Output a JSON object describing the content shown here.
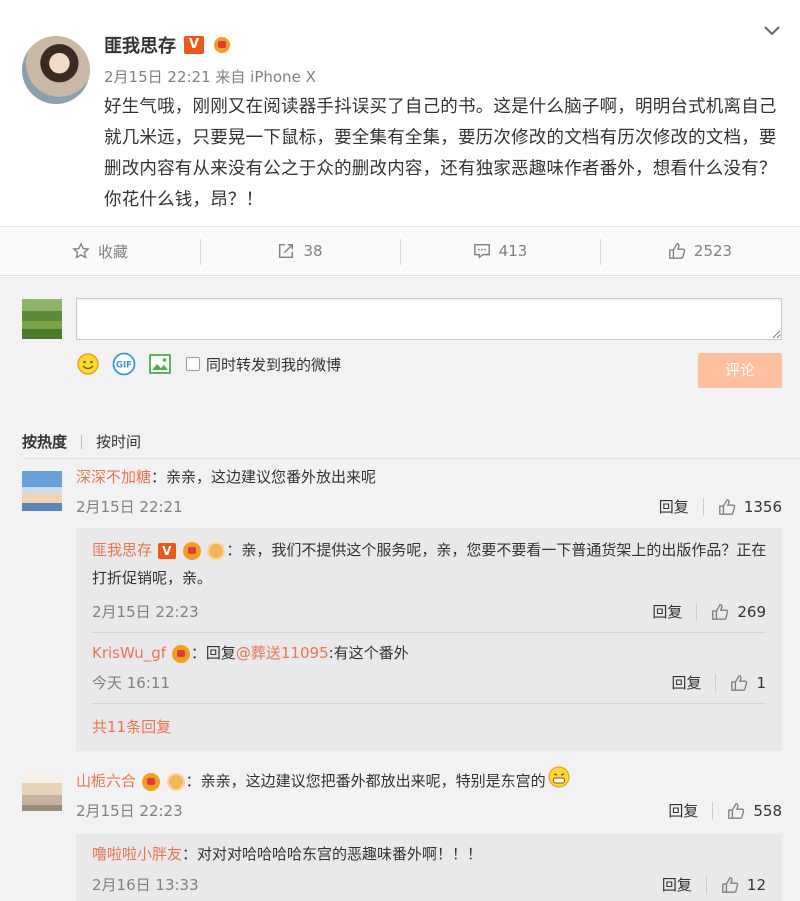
{
  "post": {
    "author": "匪我思存",
    "meta": "2月15日 22:21 来自 iPhone X",
    "body": "好生气哦，刚刚又在阅读器手抖误买了自己的书。这是什么脑子啊，明明台式机离自己就几米远，只要晃一下鼠标，要全集有全集，要历次修改的文档有历次修改的文档，要删改内容有从来没有公之于众的删改内容，还有独家恶趣味作者番外，想看什么没有？你花什么钱，昂？！"
  },
  "actions": {
    "favorite": "收藏",
    "repost": "38",
    "comment": "413",
    "like": "2523"
  },
  "composer": {
    "input_value": "",
    "repost_label": "同时转发到我的微博",
    "submit_label": "评论"
  },
  "sort": {
    "hot": "按热度",
    "time": "按时间"
  },
  "comments": [
    {
      "name": "深深不加糖",
      "text": "：亲亲，这边建议您番外放出来呢",
      "date": "2月15日 22:21",
      "reply_label": "回复",
      "likes": "1356",
      "replies": [
        {
          "name": "匪我思存",
          "text": "：亲，我们不提供这个服务呢，亲，您要不要看一下普通货架上的出版作品？正在打折促销呢，亲。",
          "date": "2月15日 22:23",
          "reply_label": "回复",
          "likes": "269"
        },
        {
          "name": "KrisWu_gf",
          "text_prefix": "：回复",
          "mention": "@葬送11095",
          "text": ":有这个番外",
          "date": "今天 16:11",
          "reply_label": "回复",
          "likes": "1"
        }
      ],
      "more": "共11条回复"
    },
    {
      "name": "山栀六合",
      "text": "：亲亲，这边建议您把番外都放出来呢，特别是东宫的",
      "date": "2月15日 22:23",
      "reply_label": "回复",
      "likes": "558",
      "replies": [
        {
          "name": "噜啦啦小胖友",
          "text": "：对对对哈哈哈哈东宫的恶趣味番外啊！！！",
          "date": "2月16日 13:33",
          "reply_label": "回复",
          "likes": "12"
        }
      ]
    }
  ],
  "colors": {
    "link": "#eb7350",
    "badge": "#e8591a",
    "submit_disabled": "#ffc09f"
  }
}
